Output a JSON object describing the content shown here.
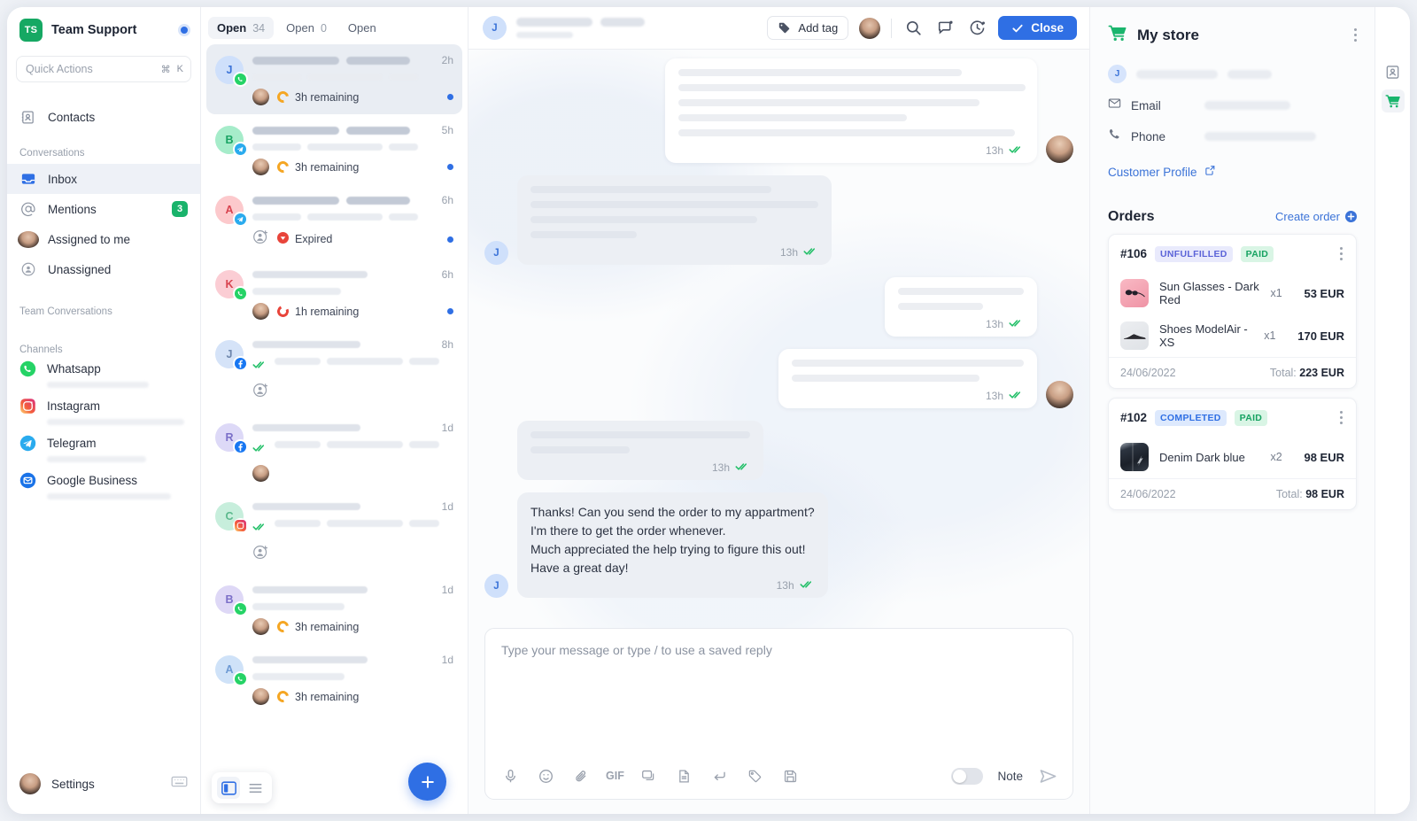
{
  "sidebar": {
    "brand": {
      "logo_initials": "TS",
      "name": "Team Support",
      "status_icon": "presence-dot"
    },
    "quick_actions": {
      "placeholder": "Quick Actions",
      "key_cmd": "⌘",
      "key_k": "K"
    },
    "primary": [
      {
        "label": "Contacts",
        "icon": "contacts-icon"
      }
    ],
    "sections": [
      {
        "title": "Conversations",
        "items": [
          {
            "label": "Inbox",
            "icon": "inbox-icon",
            "active": true,
            "badge": ""
          },
          {
            "label": "Mentions",
            "icon": "at-icon",
            "active": false,
            "badge": "3"
          },
          {
            "label": "Assigned to me",
            "icon": "avatar-icon",
            "active": false,
            "badge": ""
          },
          {
            "label": "Unassigned",
            "icon": "unassigned-icon",
            "active": false,
            "badge": ""
          }
        ]
      },
      {
        "title": "Team Conversations",
        "items": []
      }
    ],
    "channels_title": "Channels",
    "channels": [
      {
        "label": "Whatsapp",
        "icon": "whatsapp-icon",
        "color": "#25d366"
      },
      {
        "label": "Instagram",
        "icon": "instagram-icon",
        "color": "#e1306c"
      },
      {
        "label": "Telegram",
        "icon": "telegram-icon",
        "color": "#2aabee"
      },
      {
        "label": "Google Business",
        "icon": "google-business-icon",
        "color": "#1a73e8"
      }
    ],
    "settings": {
      "label": "Settings",
      "icon": "keyboard-icon"
    }
  },
  "conversation_list": {
    "tabs": [
      {
        "label": "Open",
        "count": "34",
        "active": true
      },
      {
        "label": "Open",
        "count": "0",
        "active": false
      },
      {
        "label": "Open",
        "count": "",
        "active": false
      }
    ],
    "items": [
      {
        "initial": "J",
        "avatar_color": "#cfe0fb",
        "initial_color": "#3b73d8",
        "channel": "whatsapp-icon",
        "time": "2h",
        "selected": true,
        "status": "3h remaining",
        "status_type": "sla-orange",
        "assignee": "agent",
        "unread": true,
        "read_ticks": false
      },
      {
        "initial": "B",
        "avatar_color": "#a6ecca",
        "initial_color": "#17a362",
        "channel": "telegram-icon",
        "time": "5h",
        "selected": false,
        "status": "3h remaining",
        "status_type": "sla-orange",
        "assignee": "agent",
        "unread": true,
        "read_ticks": false
      },
      {
        "initial": "A",
        "avatar_color": "#fcc9cc",
        "initial_color": "#d8434f",
        "channel": "telegram-icon",
        "time": "6h",
        "selected": false,
        "status": "Expired",
        "status_type": "expired",
        "assignee": "unassigned",
        "unread": true,
        "read_ticks": false
      },
      {
        "initial": "K",
        "avatar_color": "#fbcdd4",
        "initial_color": "#d8434f",
        "channel": "whatsapp-icon",
        "time": "6h",
        "selected": false,
        "status": "1h remaining",
        "status_type": "sla-red",
        "assignee": "agent",
        "unread": true,
        "read_ticks": false
      },
      {
        "initial": "J",
        "avatar_color": "#d5e3f8",
        "initial_color": "#6d86ac",
        "channel": "facebook-icon",
        "time": "8h",
        "selected": false,
        "status": "",
        "status_type": "none",
        "assignee": "unassigned",
        "unread": false,
        "read_ticks": true
      },
      {
        "initial": "R",
        "avatar_color": "#ddd9f7",
        "initial_color": "#7b6fc8",
        "channel": "facebook-icon",
        "time": "1d",
        "selected": false,
        "status": "",
        "status_type": "none",
        "assignee": "agent",
        "unread": false,
        "read_ticks": true
      },
      {
        "initial": "C",
        "avatar_color": "#c7eedc",
        "initial_color": "#5bb98d",
        "channel": "instagram-icon",
        "time": "1d",
        "selected": false,
        "status": "",
        "status_type": "none",
        "assignee": "unassigned",
        "unread": false,
        "read_ticks": true
      },
      {
        "initial": "B",
        "avatar_color": "#ded8f6",
        "initial_color": "#7b6fc8",
        "channel": "whatsapp-icon",
        "time": "1d",
        "selected": false,
        "status": "3h remaining",
        "status_type": "sla-orange",
        "assignee": "agent",
        "unread": false,
        "read_ticks": false
      },
      {
        "initial": "A",
        "avatar_color": "#cfe2f8",
        "initial_color": "#6d9ad4",
        "channel": "whatsapp-icon",
        "time": "1d",
        "selected": false,
        "status": "3h remaining",
        "status_type": "sla-orange",
        "assignee": "agent",
        "unread": false,
        "read_ticks": false
      }
    ],
    "view_toggle": {
      "panel_icon": "panel-view-icon",
      "list_icon": "list-view-icon",
      "active": "panel-view-icon"
    },
    "new_conversation": {
      "icon": "plus-icon",
      "label": "+"
    }
  },
  "chat": {
    "header": {
      "avatar_initial": "J",
      "add_tag_label": "Add tag",
      "add_tag_icon": "tag-icon",
      "assignee_avatar": "agent-avatar",
      "search_icon": "search-icon",
      "notes_icon": "note-bubble-icon",
      "snooze_icon": "snooze-clock-icon",
      "close_label": "Close",
      "close_icon": "check-icon"
    },
    "messages": [
      {
        "side": "out",
        "skeleton": true,
        "lines": [
          320,
          392,
          340,
          258,
          380
        ],
        "time": "13h",
        "ticks": true,
        "avatar": "agent-avatar"
      },
      {
        "side": "in",
        "skeleton": true,
        "lines": [
          272,
          325,
          256,
          120
        ],
        "time": "13h",
        "ticks": true,
        "avatar": "customer-avatar"
      },
      {
        "side": "out",
        "skeleton": true,
        "lines": [
          142,
          96
        ],
        "time": "13h",
        "ticks": true,
        "avatar": ""
      },
      {
        "side": "out",
        "skeleton": true,
        "lines": [
          262,
          212
        ],
        "time": "13h",
        "ticks": true,
        "avatar": "agent-avatar"
      },
      {
        "side": "in",
        "skeleton": true,
        "lines": [
          248,
          112
        ],
        "time": "13h",
        "ticks": true,
        "avatar": ""
      },
      {
        "side": "in",
        "skeleton": false,
        "text": "Thanks! Can you send the order to my appartment?\nI'm there to get the order whenever.\nMuch appreciated the help trying to figure this out!\nHave a great day!",
        "time": "13h",
        "ticks": true,
        "avatar": "customer-avatar"
      }
    ],
    "composer": {
      "placeholder": "Type your message or type / to use a saved reply",
      "tools": [
        {
          "icon": "microphone-icon",
          "label": ""
        },
        {
          "icon": "emoji-icon",
          "label": ""
        },
        {
          "icon": "attachment-icon",
          "label": ""
        },
        {
          "icon": "gif-icon",
          "label": "GIF"
        },
        {
          "icon": "saved-reply-icon",
          "label": ""
        },
        {
          "icon": "document-icon",
          "label": ""
        },
        {
          "icon": "enter-key-icon",
          "label": ""
        },
        {
          "icon": "tag-icon",
          "label": ""
        },
        {
          "icon": "save-disk-icon",
          "label": ""
        }
      ],
      "note_toggle_label": "Note",
      "note_toggle_on": false,
      "send_icon": "send-icon"
    }
  },
  "right_panel": {
    "store": {
      "title": "My store",
      "icon": "shopping-cart-icon",
      "menu_icon": "kebab-menu-icon"
    },
    "customer": {
      "avatar_initial": "J"
    },
    "fields": [
      {
        "label": "Email",
        "icon": "envelope-icon",
        "value_hidden": true
      },
      {
        "label": "Phone",
        "icon": "phone-icon",
        "value_hidden": true
      }
    ],
    "customer_profile_link": {
      "label": "Customer Profile",
      "icon": "external-link-icon"
    },
    "orders_title": "Orders",
    "create_order": {
      "label": "Create order",
      "icon": "plus-circle-icon"
    },
    "orders": [
      {
        "id": "#106",
        "chips": [
          {
            "text": "UNFULFILLED",
            "type": "unf"
          },
          {
            "text": "PAID",
            "type": "paid"
          }
        ],
        "items": [
          {
            "name": "Sun Glasses - Dark Red",
            "qty": "x1",
            "price": "53 EUR",
            "thumb": "sunglasses-thumb"
          },
          {
            "name": "Shoes ModelAir - XS",
            "qty": "x1",
            "price": "170 EUR",
            "thumb": "shoes-thumb"
          }
        ],
        "date": "24/06/2022",
        "total_label": "Total:",
        "total_value": "223 EUR"
      },
      {
        "id": "#102",
        "chips": [
          {
            "text": "COMPLETED",
            "type": "comp"
          },
          {
            "text": "PAID",
            "type": "paid"
          }
        ],
        "items": [
          {
            "name": "Denim Dark blue",
            "qty": "x2",
            "price": "98 EUR",
            "thumb": "denim-thumb"
          }
        ],
        "date": "24/06/2022",
        "total_label": "Total:",
        "total_value": "98 EUR"
      }
    ]
  },
  "rail": {
    "buttons": [
      {
        "icon": "contact-card-icon",
        "active": false
      },
      {
        "icon": "shopping-cart-icon",
        "active": true
      }
    ]
  },
  "colors": {
    "accent_blue": "#2f6fe4",
    "brand_green": "#16a863",
    "tick_green": "#25c06a",
    "sla_orange": "#f5a623",
    "sla_red": "#e8443a",
    "badge_green": "#19b36b"
  }
}
